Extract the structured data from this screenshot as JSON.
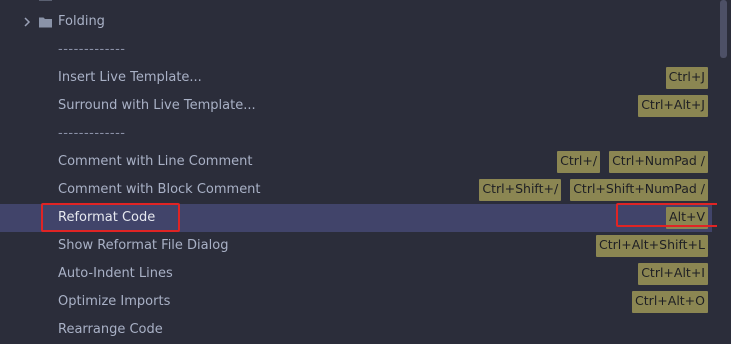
{
  "rows": [
    {
      "label": "Folding"
    },
    {
      "label": "-------------"
    },
    {
      "label": "Insert Live Template...",
      "shortcuts": [
        "Ctrl+J"
      ]
    },
    {
      "label": "Surround with Live Template...",
      "shortcuts": [
        "Ctrl+Alt+J"
      ]
    },
    {
      "label": "-------------"
    },
    {
      "label": "Comment with Line Comment",
      "shortcuts": [
        "Ctrl+/",
        "Ctrl+NumPad /"
      ]
    },
    {
      "label": "Comment with Block Comment",
      "shortcuts": [
        "Ctrl+Shift+/",
        "Ctrl+Shift+NumPad /"
      ]
    },
    {
      "label": "Reformat Code",
      "shortcuts": [
        "Alt+V"
      ]
    },
    {
      "label": "Show Reformat File Dialog",
      "shortcuts": [
        "Ctrl+Alt+Shift+L"
      ]
    },
    {
      "label": "Auto-Indent Lines",
      "shortcuts": [
        "Ctrl+Alt+I"
      ]
    },
    {
      "label": "Optimize Imports",
      "shortcuts": [
        "Ctrl+Alt+O"
      ]
    },
    {
      "label": "Rearrange Code"
    }
  ],
  "colors": {
    "background": "#2b2d3a",
    "selection": "#41446a",
    "shortcut_badge": "#8b8652",
    "highlight_box": "#e02424"
  }
}
